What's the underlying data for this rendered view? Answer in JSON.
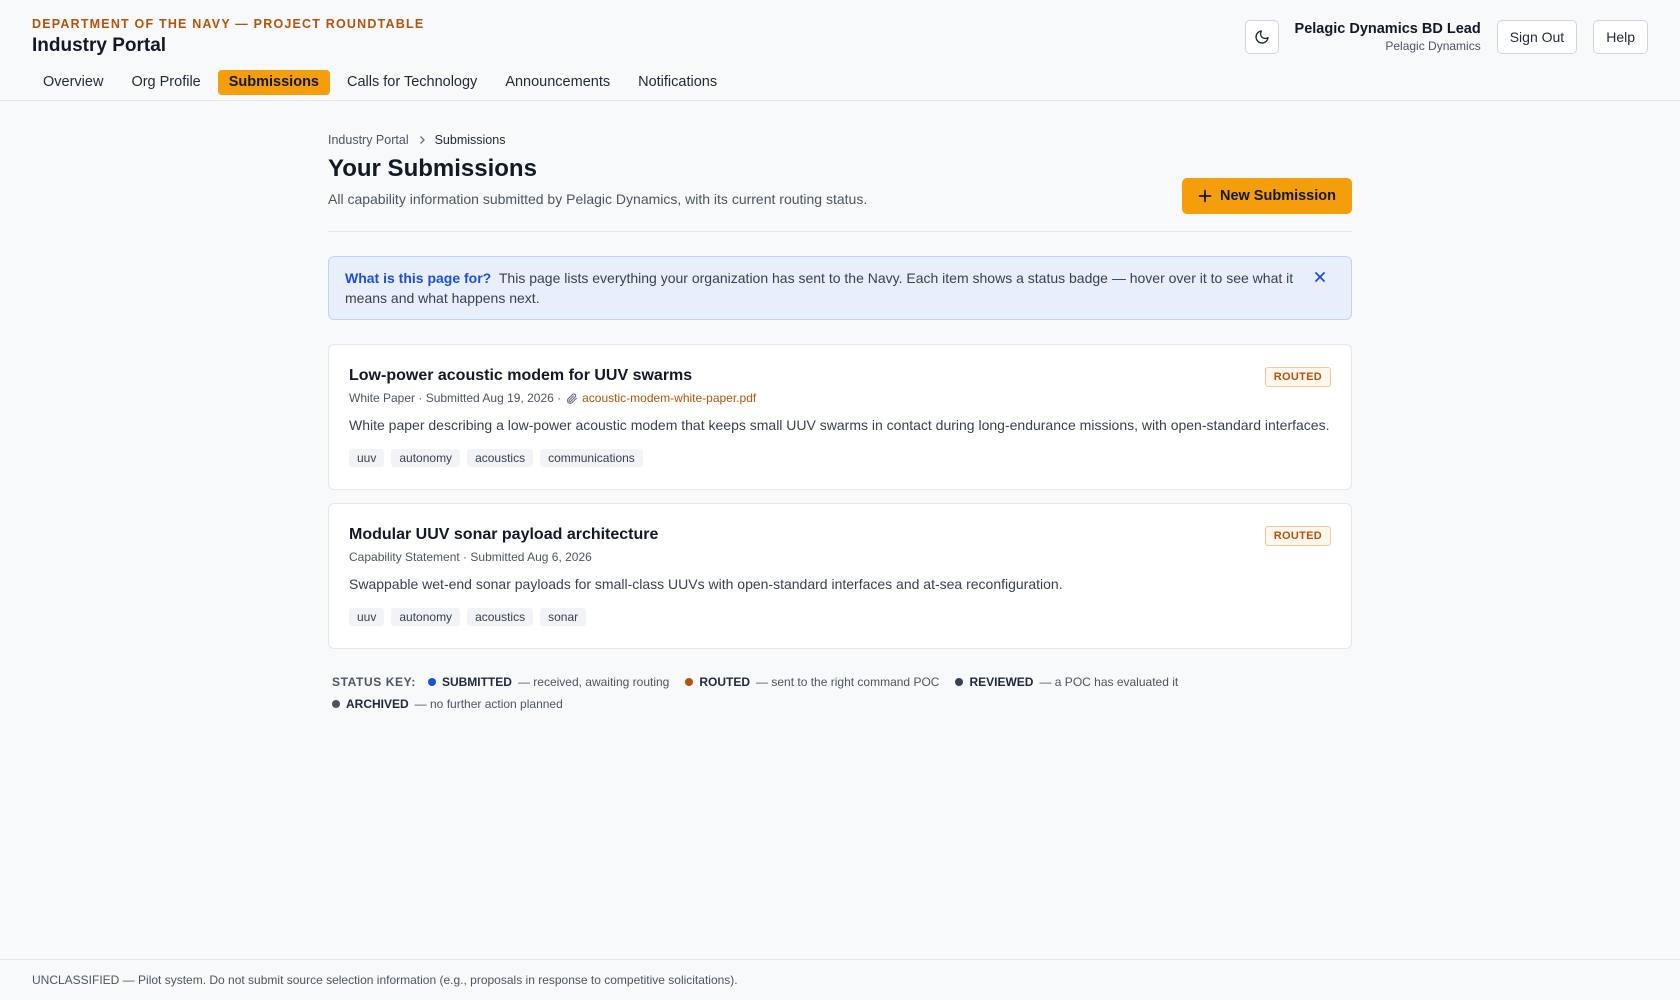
{
  "header": {
    "dept": "DEPARTMENT OF THE NAVY — PROJECT ROUNDTABLE",
    "title": "Industry Portal",
    "user_name": "Pelagic Dynamics BD Lead",
    "user_org": "Pelagic Dynamics",
    "sign_out": "Sign Out",
    "help": "Help",
    "theme_icon": "moon-icon"
  },
  "nav": {
    "tabs": [
      {
        "label": "Overview"
      },
      {
        "label": "Org Profile"
      },
      {
        "label": "Submissions",
        "active": true
      },
      {
        "label": "Calls for Technology"
      },
      {
        "label": "Announcements"
      },
      {
        "label": "Notifications"
      }
    ]
  },
  "breadcrumb": {
    "root": "Industry Portal",
    "current": "Submissions"
  },
  "page": {
    "title": "Your Submissions",
    "subtitle": "All capability information submitted by Pelagic Dynamics, with its current routing status.",
    "new_button": "New Submission"
  },
  "info": {
    "question": "What is this page for?",
    "text": "This page lists everything your organization has sent to the Navy. Each item shows a status badge — hover over it to see what it means and what happens next."
  },
  "submissions": [
    {
      "title": "Low-power acoustic modem for UUV swarms",
      "meta": "White Paper · Submitted Aug 19, 2026 ·",
      "file": "acoustic-modem-white-paper.pdf",
      "description": "White paper describing a low-power acoustic modem that keeps small UUV swarms in contact during long-endurance missions, with open-standard interfaces.",
      "tags": [
        "uuv",
        "autonomy",
        "acoustics",
        "communications"
      ],
      "status": "ROUTED"
    },
    {
      "title": "Modular UUV sonar payload architecture",
      "meta": "Capability Statement · Submitted Aug 6, 2026",
      "file": "",
      "description": "Swappable wet-end sonar payloads for small-class UUVs with open-standard interfaces and at-sea reconfiguration.",
      "tags": [
        "uuv",
        "autonomy",
        "acoustics",
        "sonar"
      ],
      "status": "ROUTED"
    }
  ],
  "status_key": {
    "label": "STATUS KEY:",
    "items": [
      {
        "name": "SUBMITTED",
        "desc": "— received, awaiting routing",
        "color": "#1d4ed8"
      },
      {
        "name": "ROUTED",
        "desc": "— sent to the right command POC",
        "color": "#b45309"
      },
      {
        "name": "REVIEWED",
        "desc": "— a POC has evaluated it",
        "color": "#374151"
      },
      {
        "name": "ARCHIVED",
        "desc": "— no further action planned",
        "color": "#4b5563"
      }
    ]
  },
  "footer": {
    "text": "UNCLASSIFIED — Pilot system. Do not submit source selection information (e.g., proposals in response to competitive solicitations)."
  },
  "colors": {
    "accent": "#f59e0b",
    "routed": "#b45309",
    "info_blue": "#1d4ed8"
  }
}
